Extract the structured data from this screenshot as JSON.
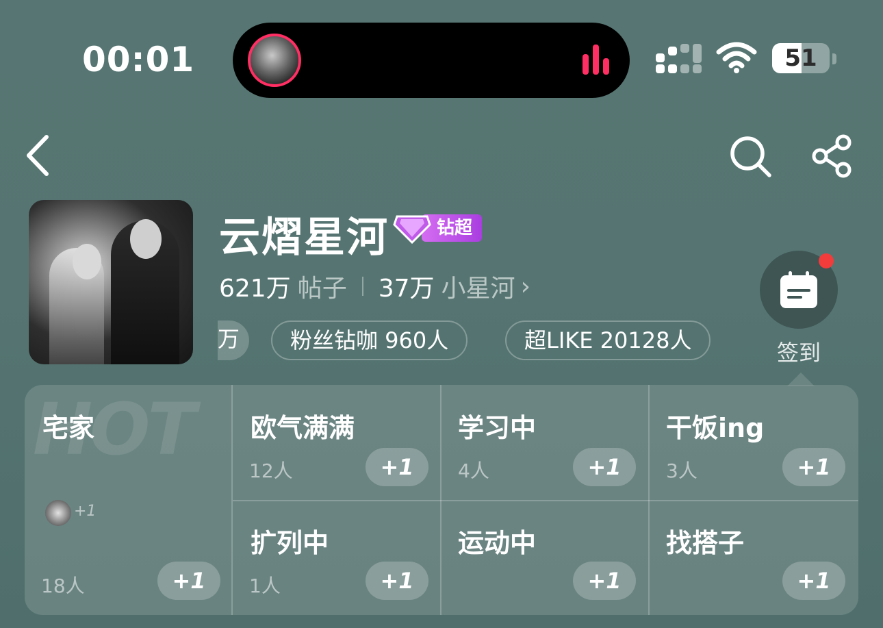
{
  "status_bar": {
    "time": "00:01",
    "battery_level": "51",
    "icons": [
      "now-playing-avatar-icon",
      "audio-equalizer-icon",
      "cellular-signal-icon",
      "wifi-icon",
      "battery-icon"
    ]
  },
  "nav": {
    "icons": [
      "back-icon",
      "search-icon",
      "share-icon"
    ]
  },
  "header": {
    "title": "云熠星河",
    "badge_label": "钻超",
    "badge_level": "1",
    "posts_count": "621万",
    "posts_label": "帖子",
    "members_count": "37万",
    "members_label": "小星河",
    "members_chevron": "›",
    "tags": [
      "万",
      "粉丝钻咖 960人",
      "超LIKE 20128人"
    ],
    "checkin_label": "签到",
    "colors": {
      "badge": "#c05ae8",
      "notification_dot": "#f23b3b",
      "island_accent": "#ff2e63"
    }
  },
  "mood_panel": {
    "watermark": "HOT",
    "featured": {
      "title": "宅家",
      "count": "18人",
      "avatar_extra": "+1",
      "button": "+1"
    },
    "items": [
      {
        "title": "欧气满满",
        "count": "12人",
        "button": "+1"
      },
      {
        "title": "学习中",
        "count": "4人",
        "button": "+1"
      },
      {
        "title": "干饭ing",
        "count": "3人",
        "button": "+1"
      },
      {
        "title": "扩列中",
        "count": "1人",
        "button": "+1"
      },
      {
        "title": "运动中",
        "count": "",
        "button": "+1"
      },
      {
        "title": "找搭子",
        "count": "",
        "button": "+1"
      }
    ]
  }
}
